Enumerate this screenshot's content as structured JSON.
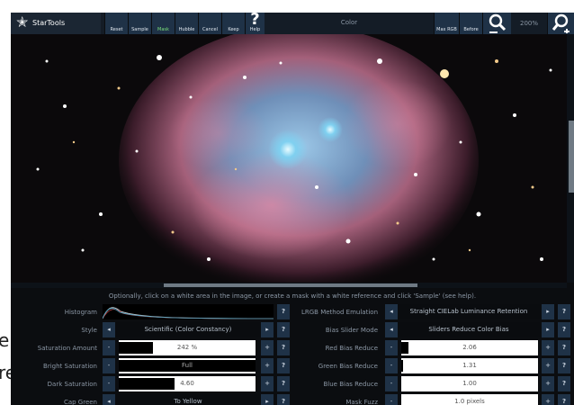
{
  "toolbar": {
    "app_name": "StarTools",
    "buttons": [
      "Reset",
      "Sample",
      "Mask",
      "Hubble",
      "Cancel",
      "Keep"
    ],
    "help_symbol": "?",
    "help_label": "Help",
    "module_title": "Color",
    "max_rgb_label": "Max RGB",
    "before_label": "Before",
    "zoom": "200%"
  },
  "hint": "Optionally, click on a white area in the image, or create a mask with a white reference and click 'Sample' (see help).",
  "stray_text": [
    "e",
    "re"
  ],
  "left_panel": {
    "histogram_label": "Histogram",
    "style_label": "Style",
    "style_value": "Scientific (Color Constancy)",
    "sliders": [
      {
        "label": "Saturation Amount",
        "value": "242 %",
        "level": 0.25
      },
      {
        "label": "Bright Saturation",
        "value": "Full",
        "level": 1.0
      },
      {
        "label": "Dark Saturation",
        "value": "4.60",
        "level": 0.41
      }
    ],
    "cap_green_label": "Cap Green",
    "cap_green_value": "To Yellow"
  },
  "right_panel": {
    "lrgb_label": "LRGB Method Emulation",
    "lrgb_value": "Straight CIELab Luminance Retention",
    "bias_mode_label": "Bias Slider Mode",
    "bias_mode_value": "Sliders Reduce Color Bias",
    "sliders": [
      {
        "label": "Red Bias Reduce",
        "value": "2.06",
        "level": 0.05
      },
      {
        "label": "Green Bias Reduce",
        "value": "1.31",
        "level": 0.015
      },
      {
        "label": "Blue Bias Reduce",
        "value": "1.00",
        "level": 0.0
      }
    ],
    "mask_fuzz_label": "Mask Fuzz",
    "mask_fuzz_value": "1.0 pixels"
  },
  "controls": {
    "dec": "-",
    "inc": "+",
    "help": "?",
    "left_arrow": "◂",
    "right_arrow": "▸"
  },
  "colors": {
    "button_bg": "#1f3247",
    "toolbar_bg": "#141c26",
    "active_text": "#7be07b"
  }
}
